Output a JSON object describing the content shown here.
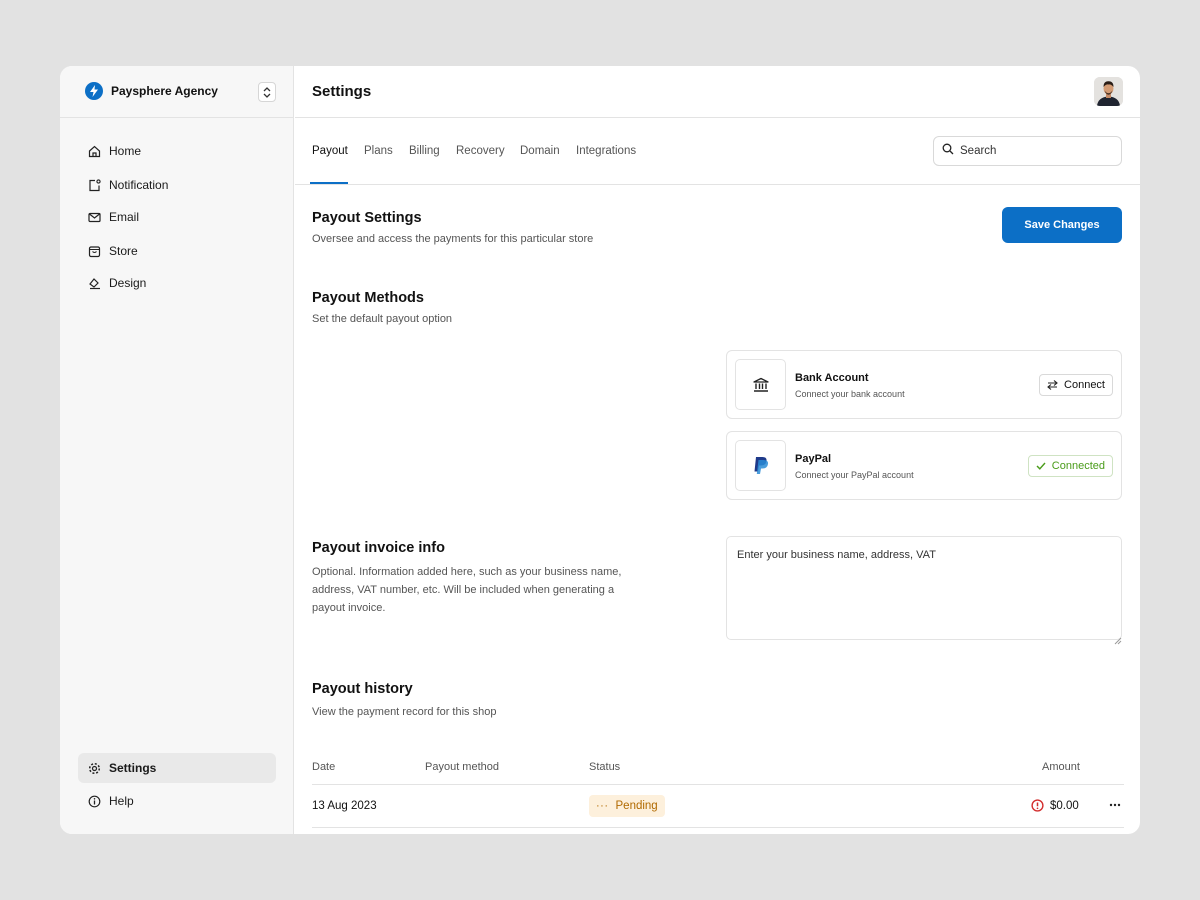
{
  "org": {
    "name": "Paysphere Agency",
    "logo_icon": "lightning-icon",
    "accent": "#0c6fc6"
  },
  "sidebar": {
    "items": [
      {
        "label": "Home",
        "icon": "home-icon"
      },
      {
        "label": "Notification",
        "icon": "notification-icon"
      },
      {
        "label": "Email",
        "icon": "mail-icon"
      },
      {
        "label": "Store",
        "icon": "store-icon"
      },
      {
        "label": "Design",
        "icon": "design-icon"
      }
    ],
    "bottom": [
      {
        "label": "Settings",
        "icon": "gear-icon",
        "active": true
      },
      {
        "label": "Help",
        "icon": "info-icon"
      }
    ]
  },
  "header": {
    "title": "Settings"
  },
  "tabs": {
    "items": [
      "Payout",
      "Plans",
      "Billing",
      "Recovery",
      "Domain",
      "Integrations"
    ],
    "active": "Payout"
  },
  "search": {
    "placeholder": "Search"
  },
  "payout_settings": {
    "title": "Payout Settings",
    "subtitle": "Oversee and access the payments for this particular store",
    "save_label": "Save Changes"
  },
  "payout_methods": {
    "title": "Payout Methods",
    "subtitle": "Set the default payout option",
    "methods": [
      {
        "name": "Bank Account",
        "description": "Connect your bank account",
        "action": "Connect",
        "connected": false,
        "icon": "bank-icon"
      },
      {
        "name": "PayPal",
        "description": "Connect your PayPal account",
        "action": "Connected",
        "connected": true,
        "icon": "paypal-icon"
      }
    ]
  },
  "invoice": {
    "title": "Payout invoice info",
    "subtitle_lines": [
      "Optional. Information added here, such as your business name,",
      "address, VAT number, etc. Will be included when generating a",
      "payout invoice."
    ],
    "placeholder": "Enter your business name, address, VAT"
  },
  "history": {
    "title": "Payout history",
    "subtitle": "View the payment record for this shop",
    "columns": {
      "date": "Date",
      "method": "Payout method",
      "status": "Status",
      "amount": "Amount"
    },
    "rows": [
      {
        "date": "13 Aug 2023",
        "method": "",
        "status": "Pending",
        "amount": "$0.00"
      }
    ],
    "status_color": "#b16a00",
    "alert_color": "#d32f2f"
  }
}
